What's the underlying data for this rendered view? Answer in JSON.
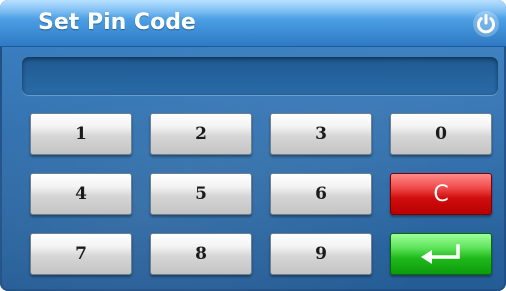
{
  "dialog": {
    "title": "Set Pin Code",
    "pin_display_value": ""
  },
  "keypad": {
    "rows": [
      [
        "1",
        "2",
        "3",
        "0"
      ],
      [
        "4",
        "5",
        "6",
        "C"
      ],
      [
        "7",
        "8",
        "9",
        ""
      ]
    ],
    "clear_label": "C",
    "enter_icon": "enter-arrow-icon"
  },
  "icons": {
    "power": "power-icon"
  },
  "colors": {
    "title_bar": "#4a9de2",
    "background": "#2f6fae",
    "clear_key": "#d00e0e",
    "enter_key": "#1fba1b",
    "key_face": "#d6d6d6"
  }
}
